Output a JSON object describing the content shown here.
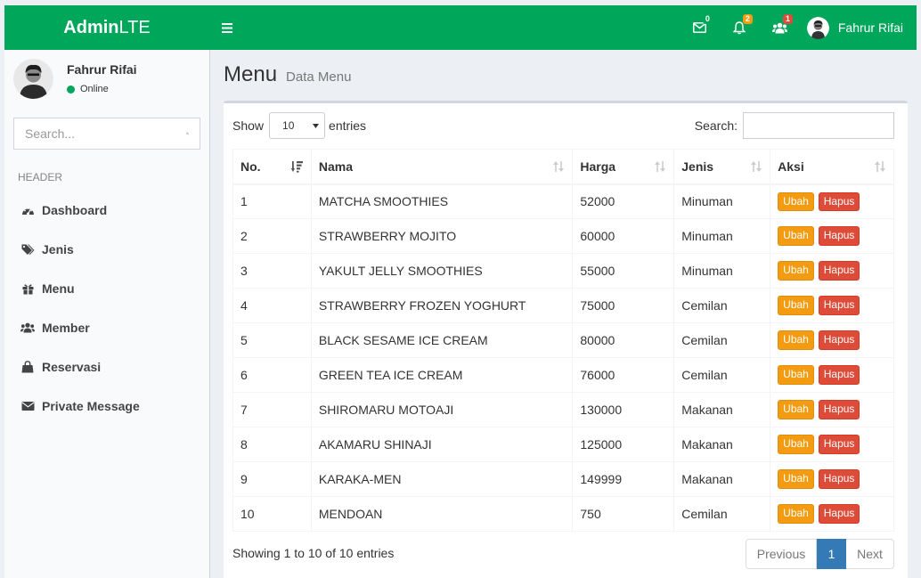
{
  "brand": {
    "logo_bold": "Admin",
    "logo_light": "LTE"
  },
  "navbar": {
    "mail_count": "0",
    "notif_count": "2",
    "users_count": "1",
    "user_name": "Fahrur Rifai",
    "colors": {
      "bg": "#00a65a",
      "mail_badge": "#00a65a",
      "notif_badge": "#f39c12",
      "users_badge": "#dd4b39"
    }
  },
  "sidebar": {
    "user_name": "Fahrur Rifai",
    "status": "Online",
    "search_placeholder": "Search...",
    "header": "HEADER",
    "items": [
      {
        "label": "Dashboard",
        "icon": "dashboard-icon"
      },
      {
        "label": "Jenis",
        "icon": "tags-icon"
      },
      {
        "label": "Menu",
        "icon": "gift-icon"
      },
      {
        "label": "Member",
        "icon": "users-icon"
      },
      {
        "label": "Reservasi",
        "icon": "shopping-bag-icon"
      },
      {
        "label": "Private Message",
        "icon": "envelope-icon"
      }
    ]
  },
  "page": {
    "title": "Menu",
    "subtitle": "Data Menu"
  },
  "datatable": {
    "show_label": "Show",
    "length_value": "10",
    "entries_label": "entries",
    "search_label": "Search:",
    "columns": [
      "No.",
      "Nama",
      "Harga",
      "Jenis",
      "Aksi"
    ],
    "rows": [
      {
        "no": "1",
        "nama": "MATCHA SMOOTHIES",
        "harga": "52000",
        "jenis": "Minuman"
      },
      {
        "no": "2",
        "nama": "STRAWBERRY MOJITO",
        "harga": "60000",
        "jenis": "Minuman"
      },
      {
        "no": "3",
        "nama": "YAKULT JELLY SMOOTHIES",
        "harga": "55000",
        "jenis": "Minuman"
      },
      {
        "no": "4",
        "nama": "STRAWBERRY FROZEN YOGHURT",
        "harga": "75000",
        "jenis": "Cemilan"
      },
      {
        "no": "5",
        "nama": "BLACK SESAME ICE CREAM",
        "harga": "80000",
        "jenis": "Cemilan"
      },
      {
        "no": "6",
        "nama": "GREEN TEA ICE CREAM",
        "harga": "76000",
        "jenis": "Cemilan"
      },
      {
        "no": "7",
        "nama": "SHIROMARU MOTOAJI",
        "harga": "130000",
        "jenis": "Makanan"
      },
      {
        "no": "8",
        "nama": "AKAMARU SHINAJI",
        "harga": "125000",
        "jenis": "Makanan"
      },
      {
        "no": "9",
        "nama": "KARAKA-MEN",
        "harga": "149999",
        "jenis": "Makanan"
      },
      {
        "no": "10",
        "nama": "MENDOAN",
        "harga": "750",
        "jenis": "Cemilan"
      }
    ],
    "edit_label": "Ubah",
    "delete_label": "Hapus",
    "info": "Showing 1 to 10 of 10 entries",
    "pagination": {
      "previous": "Previous",
      "current": "1",
      "next": "Next"
    }
  }
}
